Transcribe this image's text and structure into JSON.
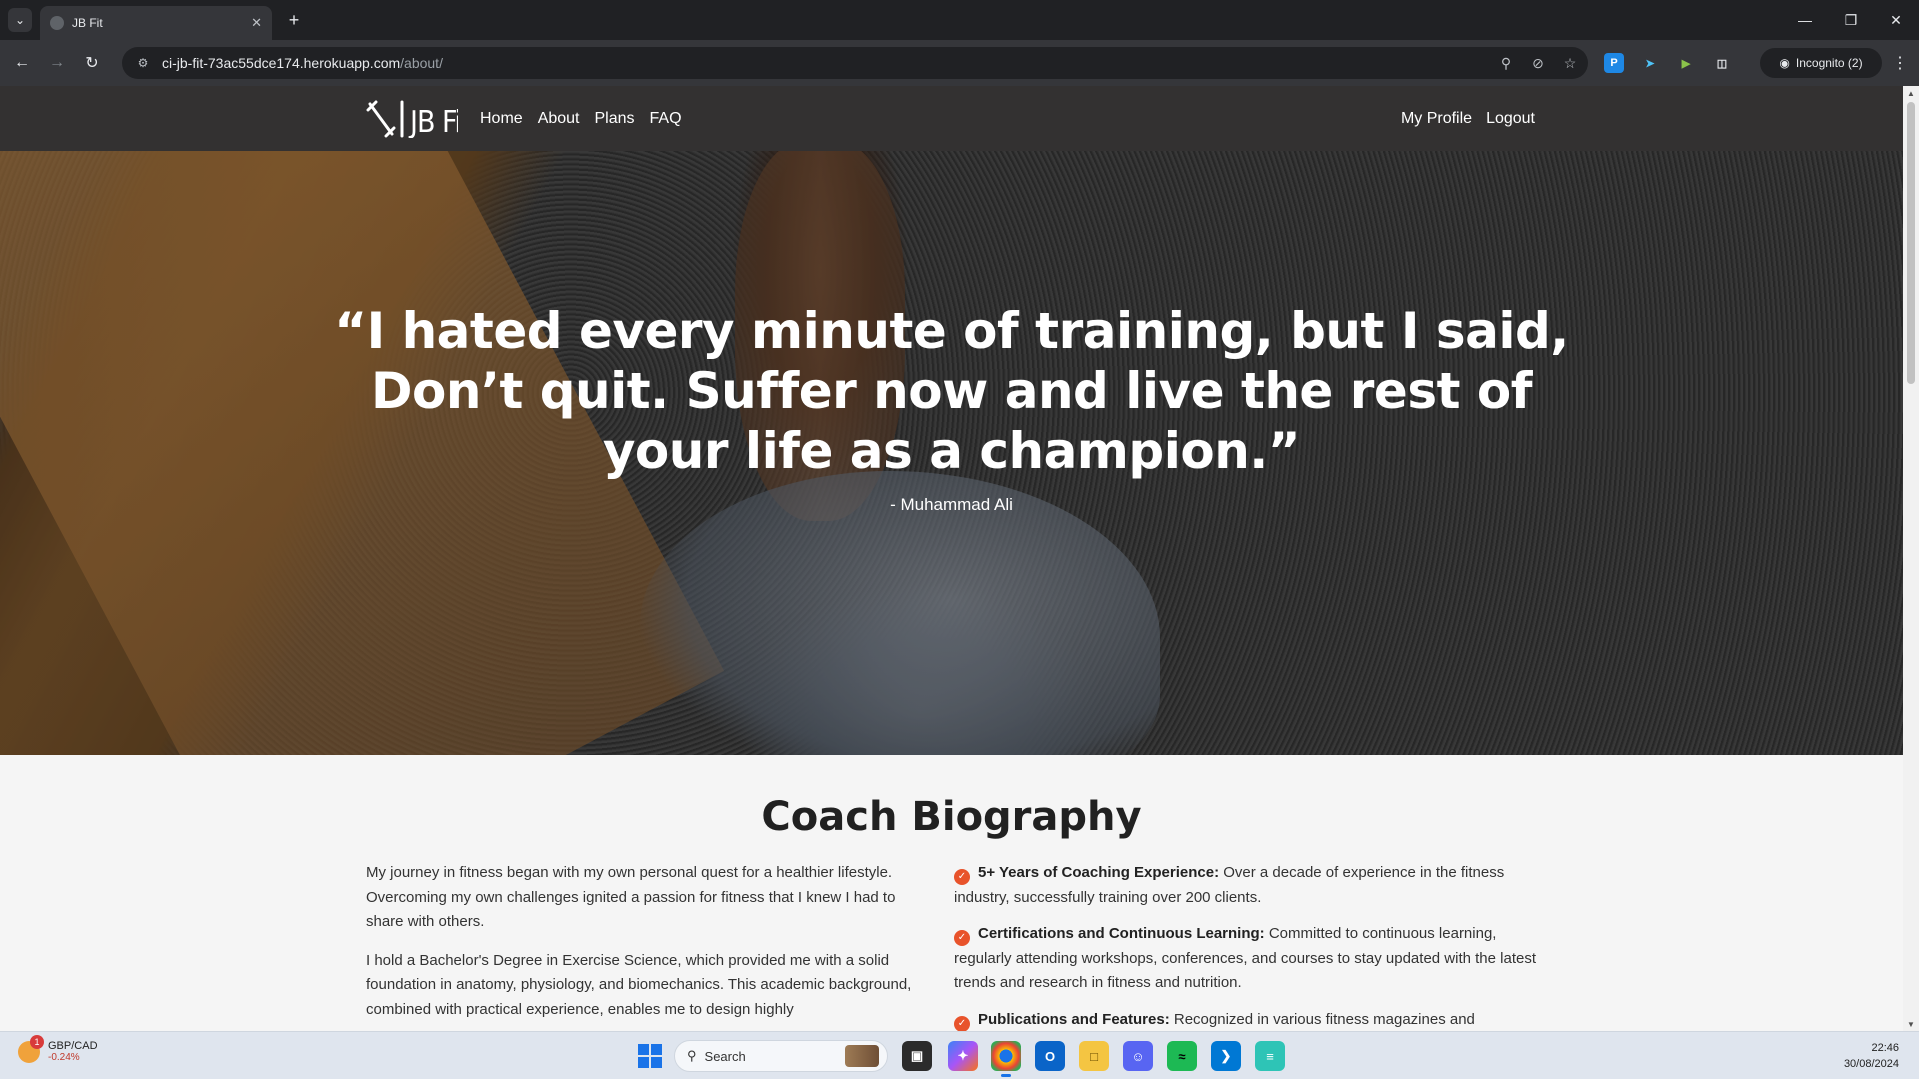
{
  "browser": {
    "tab_title": "JB Fit",
    "url_host": "ci-jb-fit-73ac55dce174.herokuapp.com",
    "url_path": "/about/",
    "incognito_label": "Incognito (2)"
  },
  "site": {
    "nav": {
      "links": [
        "Home",
        "About",
        "Plans",
        "FAQ"
      ],
      "profile": "My Profile",
      "logout": "Logout"
    },
    "hero": {
      "quote": "“I hated every minute of training, but I said, Don’t quit. Suffer now and live the rest of your life as a champion.”",
      "author": "- Muhammad Ali"
    },
    "bio": {
      "title": "Coach Biography",
      "left_paragraphs": [
        "My journey in fitness began with my own personal quest for a healthier lifestyle. Overcoming my own challenges ignited a passion for fitness that I knew I had to share with others.",
        "I hold a Bachelor's Degree in Exercise Science, which provided me with a solid foundation in anatomy, physiology, and biomechanics. This academic background, combined with practical experience, enables me to design highly"
      ],
      "items": [
        {
          "title": "5+ Years of Coaching Experience:",
          "text": " Over a decade of experience in the fitness industry, successfully training over 200 clients."
        },
        {
          "title": "Certifications and Continuous Learning:",
          "text": " Committed to continuous learning, regularly attending workshops, conferences, and courses to stay updated with the latest trends and research in fitness and nutrition."
        },
        {
          "title": "Publications and Features:",
          "text": " Recognized in various fitness magazines and"
        }
      ]
    }
  },
  "taskbar": {
    "widget_title": "GBP/CAD",
    "widget_change": "-0.24%",
    "widget_badge": "1",
    "search_placeholder": "Search",
    "time": "22:46",
    "date": "30/08/2024"
  },
  "colors": {
    "nav_bg": "#333131",
    "accent": "#e8532b"
  }
}
